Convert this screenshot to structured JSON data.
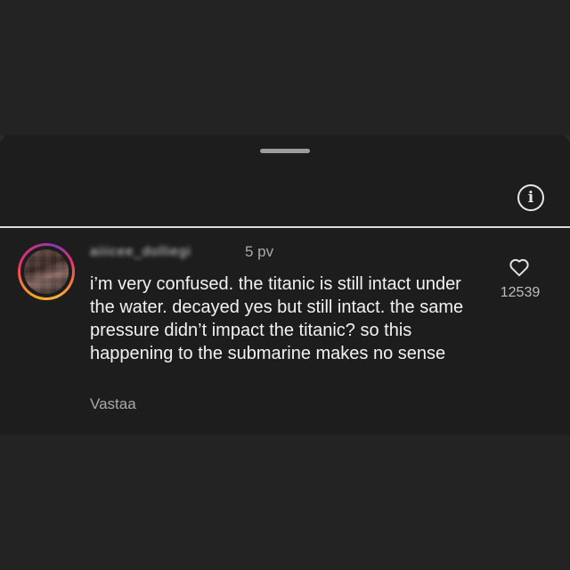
{
  "sheet": {
    "info_icon": "info-icon",
    "info_glyph": "i"
  },
  "comment": {
    "username": "aiiicee_dolliegi",
    "timestamp": "5 pv",
    "text": "i’m very confused. the titanic is still intact under the water. decayed yes but still intact. the same pressure didn’t impact the titanic? so this happening to the submarine makes no sense",
    "reply_label": "Vastaa",
    "like_icon": "heart-icon",
    "like_count": "12539"
  },
  "colors": {
    "background": "#232323",
    "sheet": "#1d1d1d",
    "text_primary": "#f2f2f2",
    "text_secondary": "#a9a9a9",
    "divider": "#dcdcdc"
  }
}
